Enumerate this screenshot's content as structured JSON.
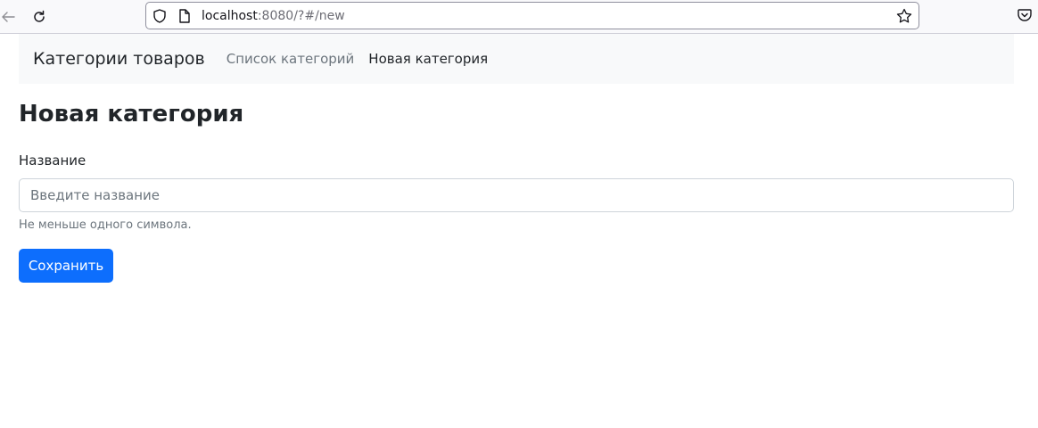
{
  "browser": {
    "url_host": "localhost",
    "url_rest": ":8080/?#/new"
  },
  "navbar": {
    "brand": "Категории товаров",
    "links": [
      {
        "label": "Список категорий",
        "active": false
      },
      {
        "label": "Новая категория",
        "active": true
      }
    ]
  },
  "form": {
    "title": "Новая категория",
    "name_label": "Название",
    "name_value": "",
    "name_placeholder": "Введите название",
    "name_help": "Не меньше одного символа.",
    "save_label": "Сохранить"
  },
  "colors": {
    "primary": "#0d6efd",
    "navbar_bg": "#f8f9fa",
    "muted_text": "#6c757d"
  }
}
